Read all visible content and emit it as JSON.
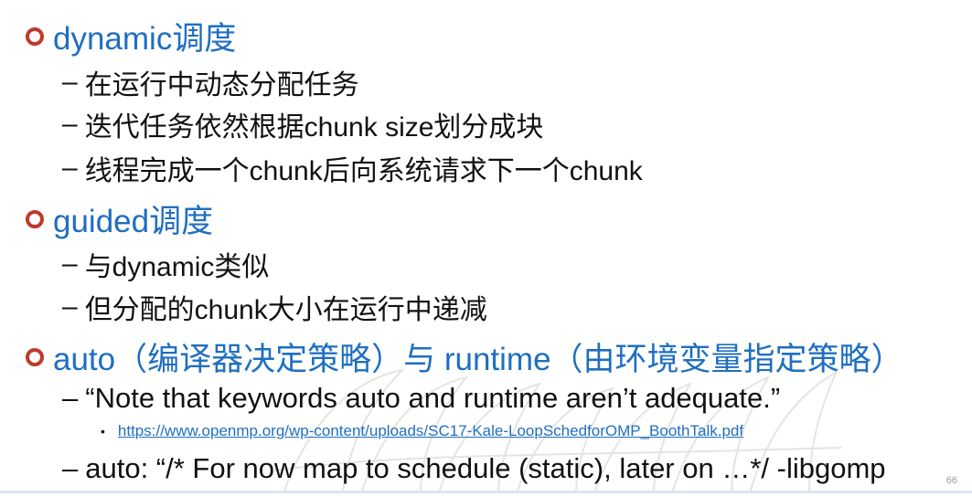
{
  "bullets": [
    {
      "title": "dynamic调度",
      "items": [
        "在运行中动态分配任务",
        "迭代任务依然根据chunk size划分成块",
        "线程完成一个chunk后向系统请求下一个chunk"
      ]
    },
    {
      "title": "guided调度",
      "items": [
        "与dynamic类似",
        "但分配的chunk大小在运行中递减"
      ]
    },
    {
      "title": "auto（编译器决定策略）与 runtime（由环境变量指定策略）",
      "items": [
        "“Note that keywords auto and runtime aren’t adequate.”",
        "auto: “/* For now map to schedule (static), later on …*/ -libgomp"
      ],
      "link": "https://www.openmp.org/wp-content/uploads/SC17-Kale-LoopSchedforOMP_BoothTalk.pdf"
    }
  ],
  "dash": "–",
  "small_bullet": "•",
  "page_number": "66",
  "colors": {
    "heading": "#1f6fc0",
    "bullet": "#c0392b",
    "text": "#111111"
  }
}
